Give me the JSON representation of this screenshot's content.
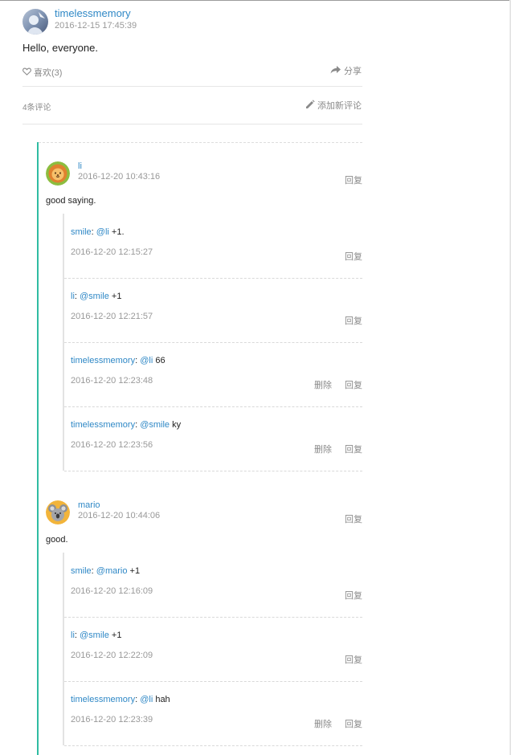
{
  "post": {
    "author": "timelessmemory",
    "time": "2016-12-15 17:45:39",
    "body": "Hello, everyone.",
    "like_label": "喜欢(3)",
    "share_label": "分享",
    "comment_count": "4条评论",
    "add_comment_label": "添加新评论"
  },
  "comments": [
    {
      "author": "li",
      "time": "2016-12-20 10:43:16",
      "body": "good saying.",
      "reply_label": "回复",
      "replies": [
        {
          "user": "smile",
          "colon": ":",
          "mention": "@li",
          "text": " +1.",
          "time": "2016-12-20 12:15:27",
          "reply_label": "回复"
        },
        {
          "user": "li",
          "colon": ":",
          "mention": "@smile",
          "text": " +1",
          "time": "2016-12-20 12:21:57",
          "reply_label": "回复"
        },
        {
          "user": "timelessmemory",
          "colon": ":",
          "mention": "@li",
          "text": " 66",
          "time": "2016-12-20 12:23:48",
          "delete_label": "删除",
          "reply_label": "回复"
        },
        {
          "user": "timelessmemory",
          "colon": ":",
          "mention": "@smile",
          "text": " ky",
          "time": "2016-12-20 12:23:56",
          "delete_label": "删除",
          "reply_label": "回复"
        }
      ]
    },
    {
      "author": "mario",
      "time": "2016-12-20 10:44:06",
      "body": "good.",
      "reply_label": "回复",
      "replies": [
        {
          "user": "smile",
          "colon": ":",
          "mention": "@mario",
          "text": " +1",
          "time": "2016-12-20 12:16:09",
          "reply_label": "回复"
        },
        {
          "user": "li",
          "colon": ":",
          "mention": "@smile",
          "text": " +1",
          "time": "2016-12-20 12:22:09",
          "reply_label": "回复"
        },
        {
          "user": "timelessmemory",
          "colon": ":",
          "mention": "@li",
          "text": " hah",
          "time": "2016-12-20 12:23:39",
          "delete_label": "删除",
          "reply_label": "回复"
        }
      ]
    }
  ],
  "icons": {
    "like": "heart-outline-icon",
    "share": "share-arrow-icon",
    "add_comment": "pencil-icon",
    "li_avatar": "lion-avatar",
    "mario_avatar": "koala-avatar"
  },
  "colors": {
    "link": "#2f88c6",
    "accent_bar": "#2fbca2",
    "muted": "#8a8a8a"
  }
}
